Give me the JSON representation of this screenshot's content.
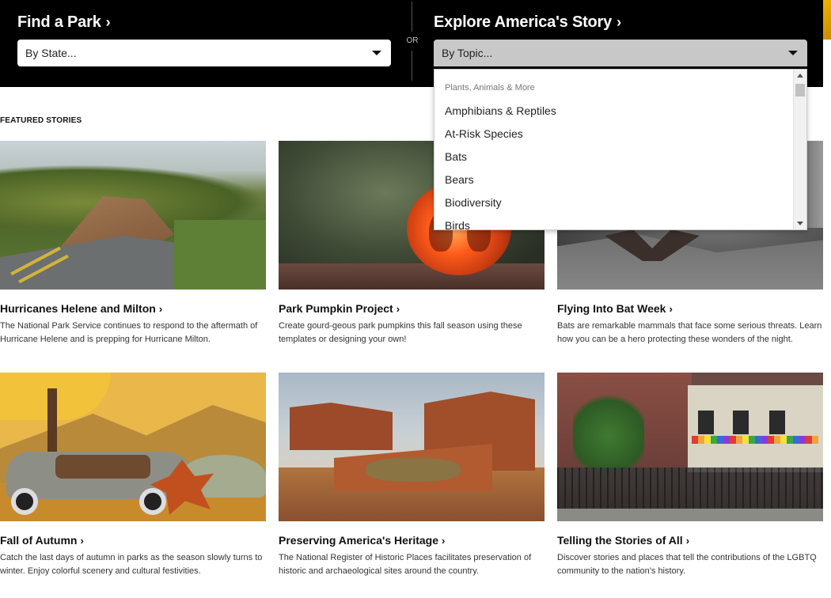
{
  "header": {
    "find_title": "Find a Park",
    "find_select": "By State...",
    "or_label": "OR",
    "explore_title": "Explore America's Story",
    "explore_select": "By Topic..."
  },
  "dropdown": {
    "group": "Plants, Animals & More",
    "items": [
      "Amphibians & Reptiles",
      "At-Risk Species",
      "Bats",
      "Bears",
      "Biodiversity",
      "Birds"
    ]
  },
  "featured": {
    "label": "FEATURED STORIES",
    "stories": [
      {
        "title": "Hurricanes Helene and Milton",
        "desc": "The National Park Service continues to respond to the aftermath of Hurricane Helene and is prepping for Hurricane Milton."
      },
      {
        "title": "Park Pumpkin Project",
        "desc": "Create gourd-geous park pumpkins this fall season using these templates or designing your own!"
      },
      {
        "title": "Flying Into Bat Week",
        "desc": "Bats are remarkable mammals that face some serious threats. Learn how you can be a hero protecting these wonders of the night."
      },
      {
        "title": "Fall of Autumn",
        "desc": "Catch the last days of autumn in parks as the season slowly turns to winter. Enjoy colorful scenery and cultural festivities."
      },
      {
        "title": "Preserving America's Heritage",
        "desc": "The National Register of Historic Places facilitates preservation of historic and archaeological sites around the country."
      },
      {
        "title": "Telling the Stories of All",
        "desc": "Discover stories and places that tell the contributions of the LGBTQ community to the nation's history."
      }
    ]
  },
  "icons": {
    "chevron": "chevron-right-icon",
    "caret": "caret-down-icon"
  },
  "colors": {
    "header_bg": "#000000",
    "select_active": "#c8c8c8"
  }
}
